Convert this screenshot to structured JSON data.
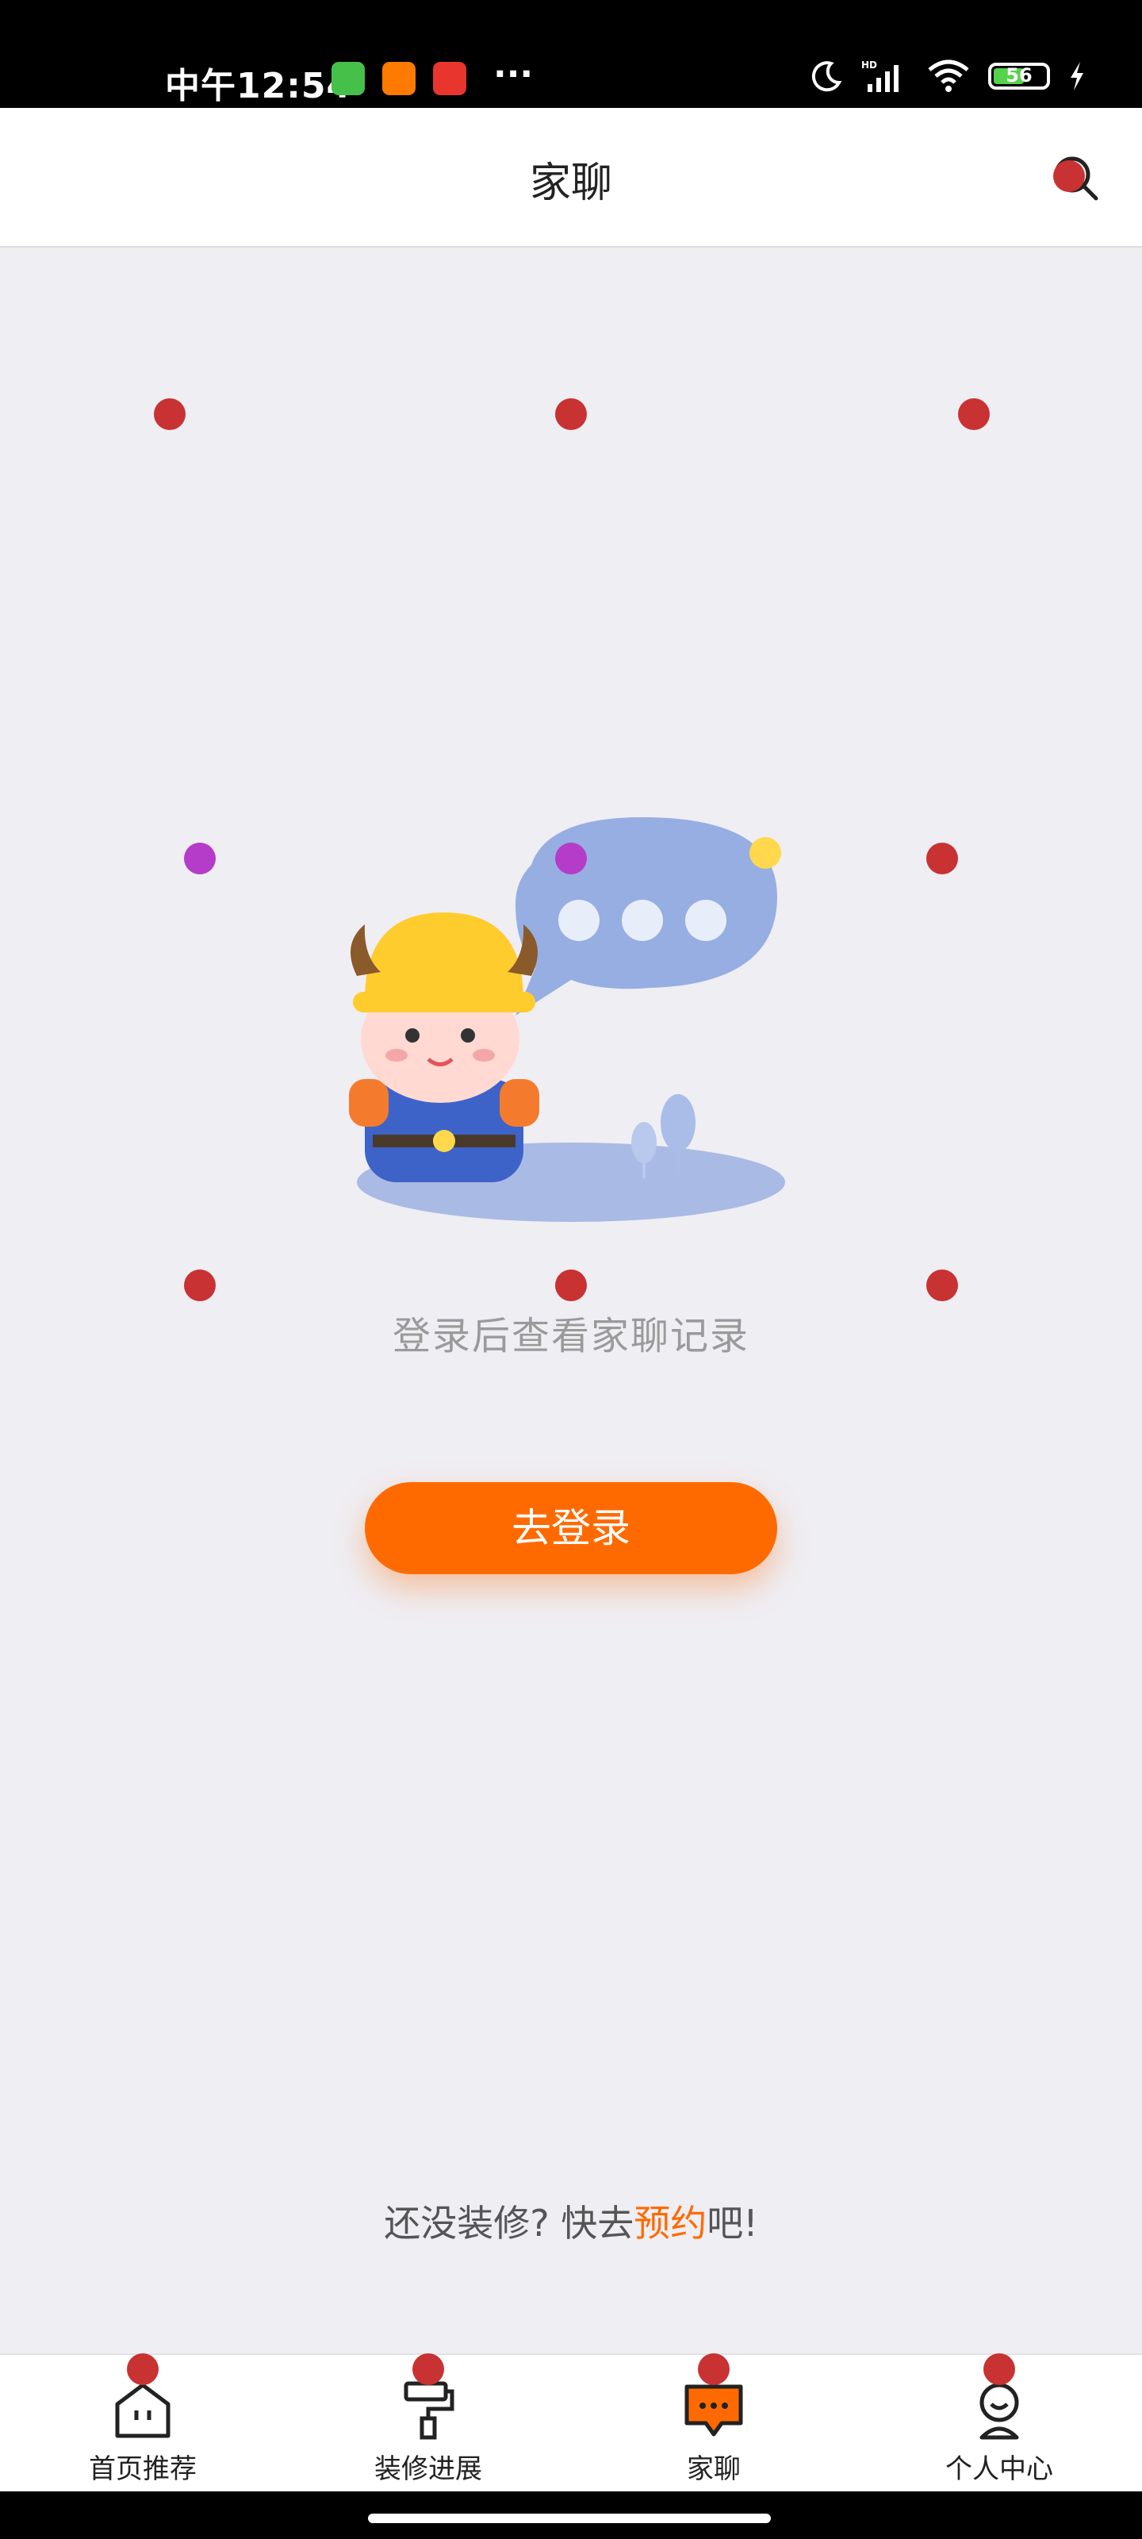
{
  "status_bar": {
    "time": "中午12:54",
    "more": "···",
    "battery": "56",
    "icons": [
      "app-icon-green",
      "app-icon-orange",
      "app-icon-red",
      "moon-icon",
      "hd-signal-icon",
      "wifi-icon",
      "battery-icon",
      "charging-icon"
    ]
  },
  "header": {
    "title": "家聊",
    "search_icon": "search-icon"
  },
  "main": {
    "empty_message": "登录后查看家聊记录",
    "login_button": "去登录",
    "promo_prefix": "还没装修? 快去",
    "promo_link": "预约",
    "promo_suffix": "吧!"
  },
  "bottom_nav": {
    "items": [
      {
        "label": "首页推荐",
        "icon": "home-icon"
      },
      {
        "label": "装修进展",
        "icon": "paint-roller-icon"
      },
      {
        "label": "家聊",
        "icon": "chat-icon"
      },
      {
        "label": "个人中心",
        "icon": "profile-icon"
      }
    ],
    "active_index": 2
  },
  "colors": {
    "accent": "#ff6a00",
    "background": "#efeef3",
    "marker_red": "#c83232",
    "marker_purple": "#b43cc8"
  }
}
